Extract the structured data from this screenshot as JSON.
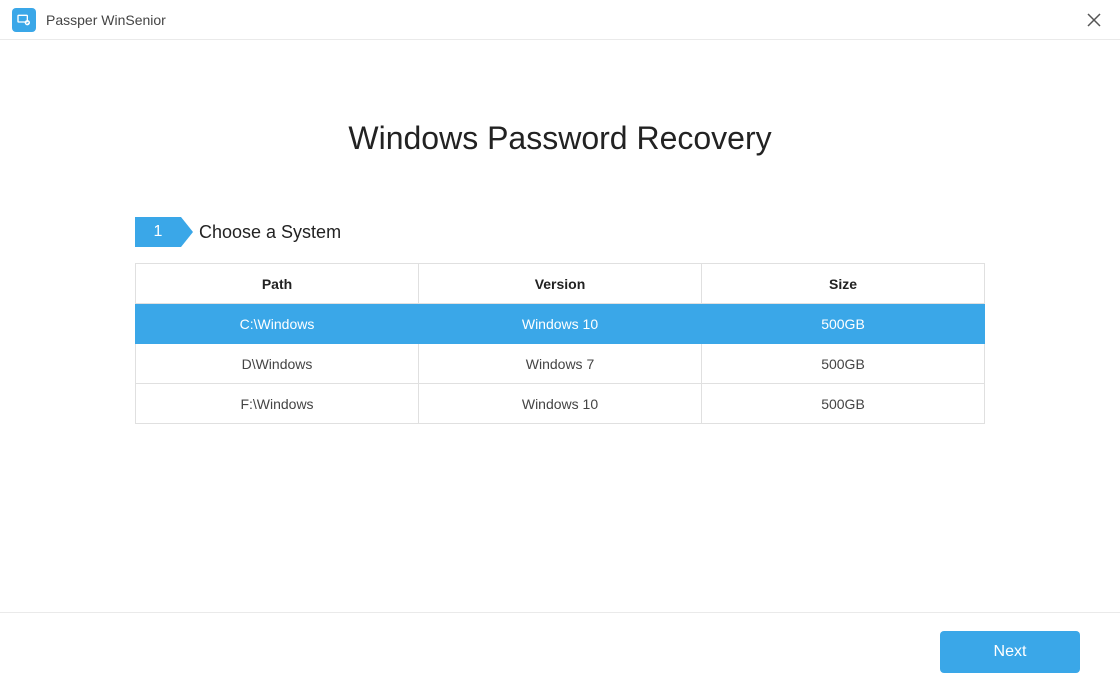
{
  "app": {
    "title": "Passper WinSenior"
  },
  "page": {
    "title": "Windows Password Recovery"
  },
  "step": {
    "number": "1",
    "label": "Choose a System"
  },
  "table": {
    "headers": {
      "path": "Path",
      "version": "Version",
      "size": "Size"
    },
    "rows": [
      {
        "path": "C:\\Windows",
        "version": "Windows 10",
        "size": "500GB",
        "selected": true
      },
      {
        "path": "D\\Windows",
        "version": "Windows 7",
        "size": "500GB",
        "selected": false
      },
      {
        "path": "F:\\Windows",
        "version": "Windows 10",
        "size": "500GB",
        "selected": false
      }
    ]
  },
  "footer": {
    "next": "Next"
  }
}
